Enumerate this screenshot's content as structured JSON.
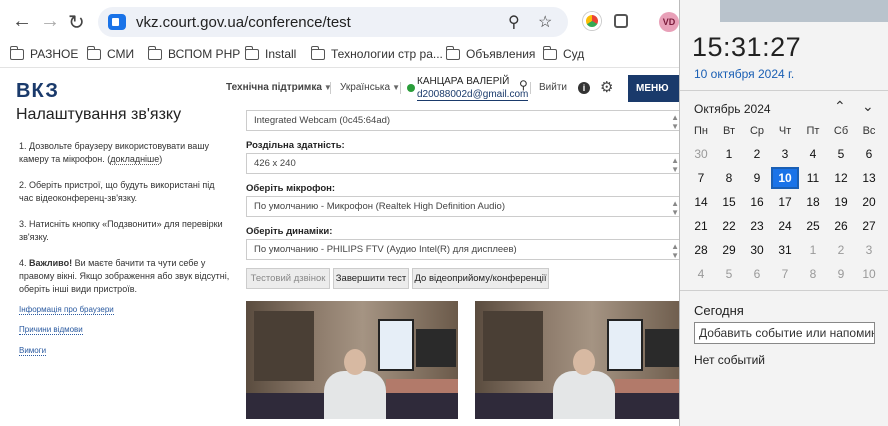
{
  "browser": {
    "url": "vkz.court.gov.ua/conference/test",
    "back_icon": "arrow-left-icon",
    "forward_icon": "arrow-right-icon",
    "reload_icon": "reload-icon",
    "zoom_icon": "zoom-icon",
    "star_icon": "star-icon",
    "avatar_initials": "VD",
    "bookmarks": [
      "РАЗНОЕ",
      "СМИ",
      "ВСПОМ PHP",
      "Install",
      "Технологии стр ра...",
      "Объявления",
      "Суд"
    ]
  },
  "header": {
    "logo": "ВКЗ",
    "support_label": "Технічна підтримка",
    "language": "Українська",
    "user_name": "КАНЦАРА ВАЛЕРІЙ",
    "user_email": "d20088002d@gmail.com",
    "logout_label": "Вийти",
    "menu_label": "МЕНЮ"
  },
  "page": {
    "title": "Налаштування зв'язку",
    "steps": {
      "step1_text": "Дозвольте браузеру використовувати вашу камеру та мікрофон. (",
      "step1_link": "докладніше",
      "step1_tail": ")",
      "step2": "Оберіть пристрої, що будуть використані під час відеоконференц-зв'язку.",
      "step3": "Натисніть кнопку «Подзвонити» для перевірки зв'язку.",
      "step4_bold": "Важливо!",
      "step4_text": " Ви маєте бачити та чути себе у правому вікні. Якщо зображення або звук відсутні, оберіть інші види пристроїв."
    },
    "side_links": [
      "Інформація про браузери",
      "Причини відмови",
      "Вимоги"
    ]
  },
  "form": {
    "camera_value": "Integrated Webcam (0c45:64ad)",
    "resolution_label": "Роздільна здатність:",
    "resolution_value": "426 x 240",
    "mic_label": "Оберіть мікрофон:",
    "mic_value": "По умолчанию - Микрофон (Realtek High Definition Audio)",
    "speaker_label": "Оберіть динаміки:",
    "speaker_value": "По умолчанию - PHILIPS FTV (Аудио Intel(R) для дисплеев)",
    "test_call_button": "Тестовий дзвінок",
    "finish_test_button": "Завершити тест",
    "to_reception_button": "До відеоприйому/конференції"
  },
  "calendar": {
    "time": "15:31:27",
    "date": "10 октября 2024 г.",
    "month": "Октябрь 2024",
    "weekdays": [
      "Пн",
      "Вт",
      "Ср",
      "Чт",
      "Пт",
      "Сб",
      "Вс"
    ],
    "weeks": [
      [
        "30",
        "1",
        "2",
        "3",
        "4",
        "5",
        "6"
      ],
      [
        "7",
        "8",
        "9",
        "10",
        "11",
        "12",
        "13"
      ],
      [
        "14",
        "15",
        "16",
        "17",
        "18",
        "19",
        "20"
      ],
      [
        "21",
        "22",
        "23",
        "24",
        "25",
        "26",
        "27"
      ],
      [
        "28",
        "29",
        "30",
        "31",
        "1",
        "2",
        "3"
      ],
      [
        "4",
        "5",
        "6",
        "7",
        "8",
        "9",
        "10"
      ]
    ],
    "today_label": "Сегодня",
    "add_event_placeholder": "Добавить событие или напомина",
    "no_events": "Нет событий"
  },
  "colors": {
    "accent": "#1a73e8",
    "brand_navy": "#1a3a6b",
    "online": "#2a9d3a"
  }
}
